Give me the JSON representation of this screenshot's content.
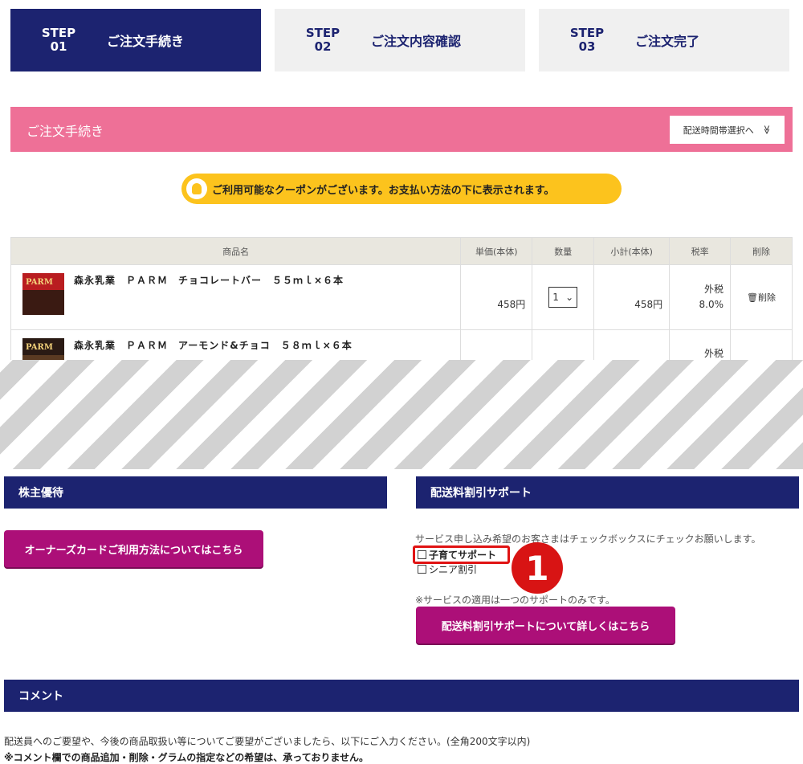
{
  "steps": [
    {
      "num": "STEP\n01",
      "step": "STEP",
      "n": "01",
      "label": "ご注文手続き"
    },
    {
      "step": "STEP",
      "n": "02",
      "label": "ご注文内容確認"
    },
    {
      "step": "STEP",
      "n": "03",
      "label": "ご注文完了"
    }
  ],
  "header": {
    "title": "ご注文手続き",
    "delivery_button": "配送時間帯選択へ",
    "chevron": "≫"
  },
  "coupon": {
    "text": "ご利用可能なクーポンがございます。お支払い方法の下に表示されます。"
  },
  "table": {
    "headers": [
      "商品名",
      "単価(本体)",
      "数量",
      "小計(本体)",
      "税率",
      "削除"
    ],
    "rows": [
      {
        "thumb": "PARM",
        "name": "森永乳業　ＰＡＲＭ　チョコレートバー　５５ｍｌ×６本",
        "price": "458円",
        "qty": "1",
        "subtotal": "458円",
        "tax_type": "外税",
        "tax_rate": "8.0%",
        "delete": "削除"
      },
      {
        "thumb": "PARM",
        "name": "森永乳業　ＰＡＲＭ　アーモンド&チョコ　５８ｍｌ×６本",
        "tax_type": "外税"
      }
    ]
  },
  "shareholder": {
    "title": "株主優待",
    "button": "オーナーズカードご利用方法についてはこちら"
  },
  "shipping_support": {
    "title": "配送料割引サポート",
    "instruction": "サービス申し込み希望のお客さまはチェックボックスにチェックお願いします。",
    "options": [
      "子育てサポート",
      "シニア割引"
    ],
    "badge": "1",
    "note": "※サービスの適用は一つのサポートのみです。",
    "button": "配送料割引サポートについて詳しくはこちら"
  },
  "comment": {
    "title": "コメント",
    "description": "配送員へのご要望や、今後の商品取扱い等についてご要望がございましたら、以下にご入力ください。(全角200文字以内)",
    "warning": "※コメント欄での商品追加・削除・グラムの指定などの希望は、承っておりません。"
  },
  "colors": {
    "navy": "#1c2370",
    "pink": "#ee7097",
    "yellow": "#fcc31d",
    "magenta": "#ac0f78",
    "red": "#d81414"
  }
}
